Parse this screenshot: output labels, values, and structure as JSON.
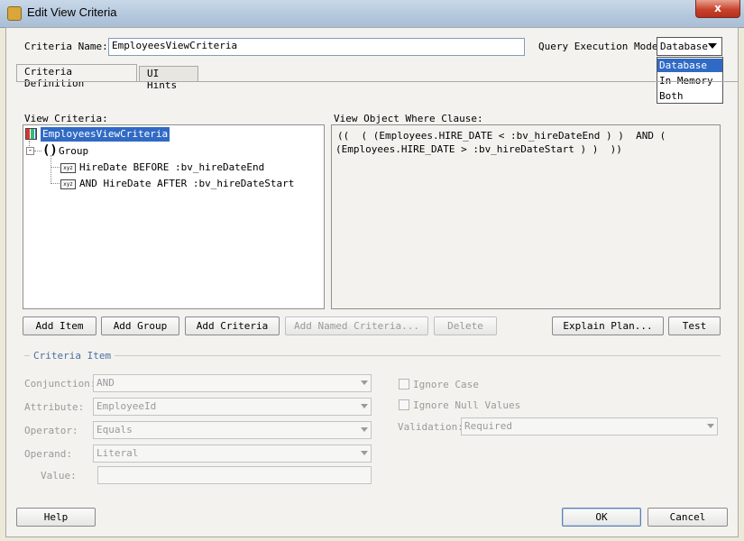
{
  "window": {
    "title": "Edit View Criteria",
    "close_symbol": "x"
  },
  "criteria_name": {
    "label": "Criteria Name:",
    "value": "EmployeesViewCriteria"
  },
  "query_mode": {
    "label": "Query Execution Mode:",
    "selected": "Database",
    "options": [
      "Database",
      "In Memory",
      "Both"
    ]
  },
  "tabs": [
    {
      "label": "Criteria Definition"
    },
    {
      "label": "UI Hints"
    }
  ],
  "view_criteria": {
    "label": "View Criteria:",
    "root": "EmployeesViewCriteria",
    "group_symbol": "()",
    "group": "Group",
    "item_icon": "xyz",
    "items": [
      "HireDate BEFORE :bv_hireDateEnd",
      "AND HireDate AFTER :bv_hireDateStart"
    ]
  },
  "where_clause": {
    "label": "View Object Where Clause:",
    "line1": "((  ( (Employees.HIRE_DATE < :bv_hireDateEnd ) )  AND (",
    "line2": "(Employees.HIRE_DATE > :bv_hireDateStart ) )  ))"
  },
  "buttons": {
    "add_item": "Add Item",
    "add_group": "Add Group",
    "add_criteria": "Add Criteria",
    "add_named_criteria": "Add Named Criteria...",
    "delete": "Delete",
    "explain_plan": "Explain Plan...",
    "test": "Test",
    "help": "Help",
    "ok": "OK",
    "cancel": "Cancel"
  },
  "criteria_item": {
    "section": "Criteria Item",
    "conjunction": {
      "label": "Conjunction:",
      "value": "AND"
    },
    "attribute": {
      "label": "Attribute:",
      "value": "EmployeeId"
    },
    "operator": {
      "label": "Operator:",
      "value": "Equals"
    },
    "operand": {
      "label": "Operand:",
      "value": "Literal"
    },
    "value": {
      "label": "Value:",
      "value": ""
    },
    "ignore_case": "Ignore Case",
    "ignore_null": "Ignore Null Values",
    "validation": {
      "label": "Validation:",
      "value": "Required"
    }
  },
  "colors": {
    "selection": "#316ac5",
    "accent_blue": "#4a6fa5"
  }
}
